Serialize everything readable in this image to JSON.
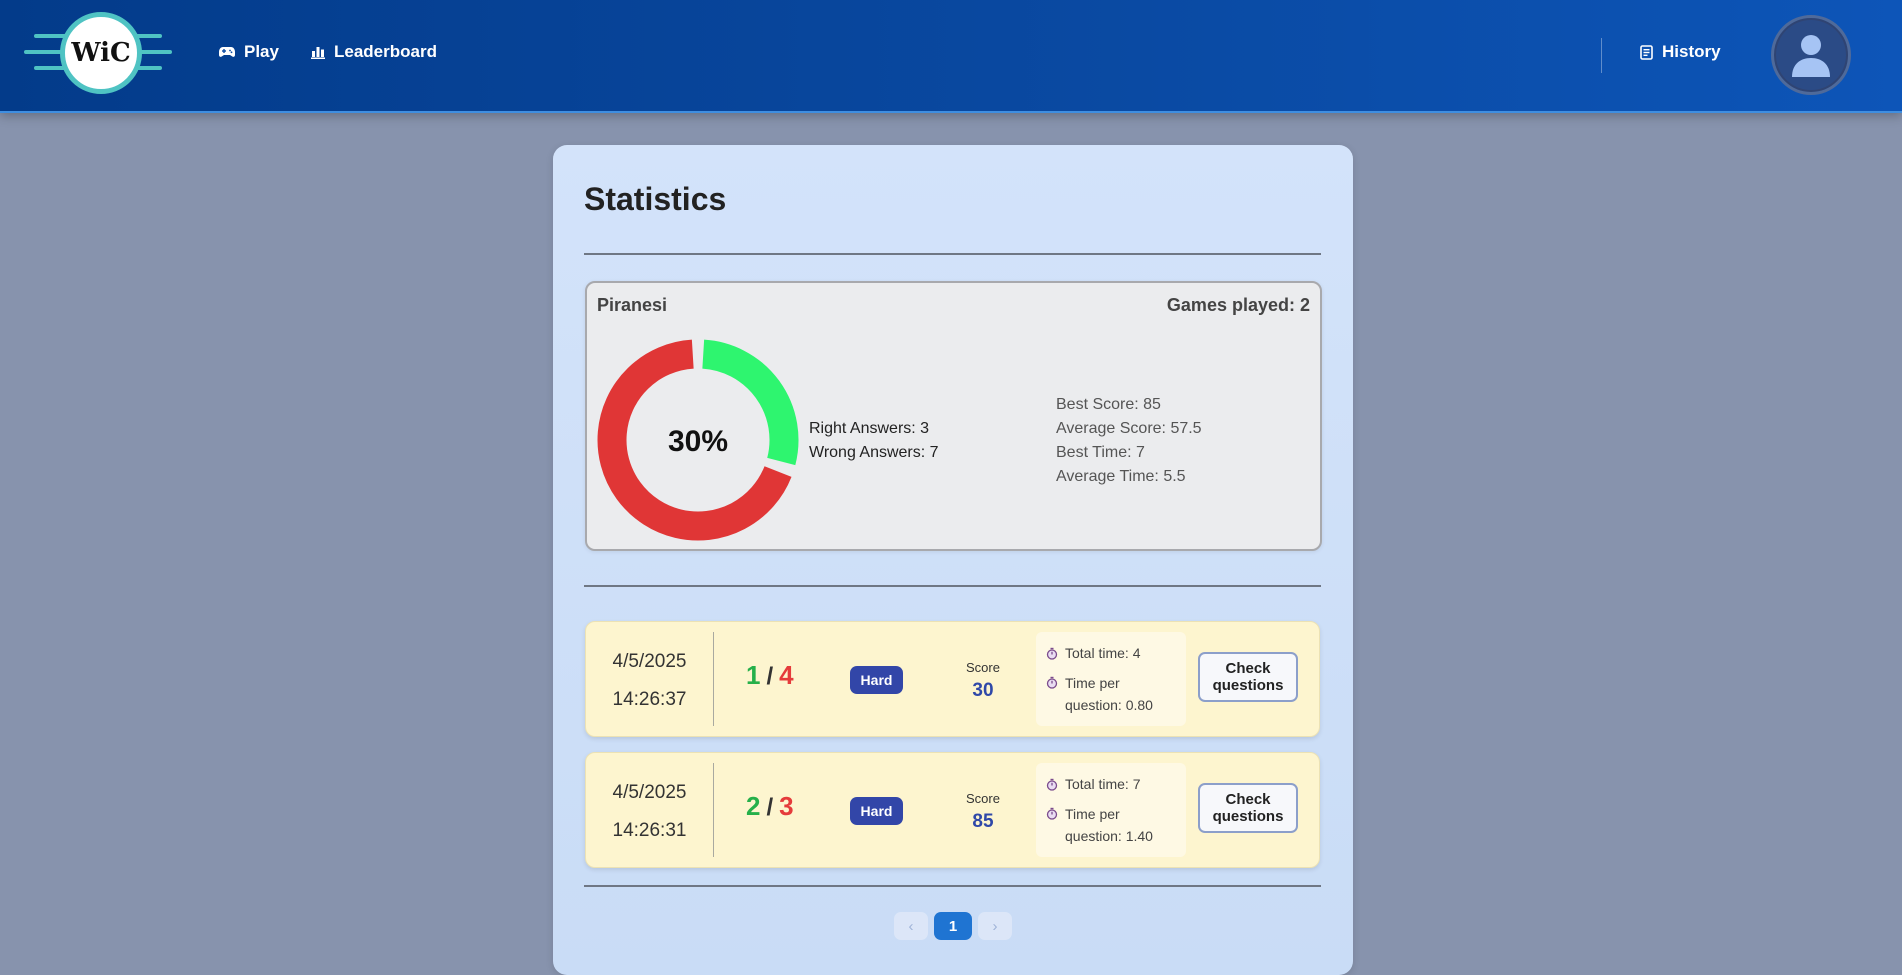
{
  "header": {
    "logo_text": "WiC",
    "nav": {
      "play": "Play",
      "leaderboard": "Leaderboard",
      "history": "History"
    }
  },
  "stats": {
    "title": "Statistics",
    "username": "Piranesi",
    "games_played": "Games played: 2",
    "percent": "30%",
    "right_fraction": 0.3,
    "right_answers": "Right Answers: 3",
    "wrong_answers": "Wrong Answers: 7",
    "best_score": "Best Score: 85",
    "average_score": "Average Score: 57.5",
    "best_time": "Best Time: 7",
    "average_time": "Average Time: 5.5"
  },
  "games": [
    {
      "date": "4/5/2025",
      "time": "14:26:37",
      "right": "1",
      "slash": "/",
      "wrong": "4",
      "difficulty": "Hard",
      "score_label": "Score",
      "score": "30",
      "total_time": "Total time: 4",
      "time_per_question": "Time per question: 0.80",
      "check_label": "Check questions"
    },
    {
      "date": "4/5/2025",
      "time": "14:26:31",
      "right": "2",
      "slash": "/",
      "wrong": "3",
      "difficulty": "Hard",
      "score_label": "Score",
      "score": "85",
      "total_time": "Total time: 7",
      "time_per_question": "Time per question: 1.40",
      "check_label": "Check questions"
    }
  ],
  "pagination": {
    "prev": "‹",
    "current": "1",
    "next": "›"
  },
  "colors": {
    "right": "#25b04a",
    "wrong": "#e53b3b",
    "donut_right": "#2ef56f",
    "donut_wrong": "#e03636",
    "badge": "#3246a8"
  }
}
